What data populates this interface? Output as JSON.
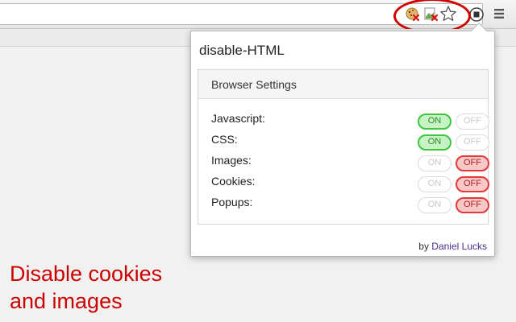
{
  "browser": {
    "extension_icons": [
      "cookie-disabled-icon",
      "image-disabled-icon"
    ],
    "bookmark_icon": "star-icon",
    "action_icon": "extension-action-icon",
    "menu_icon": "menu-icon",
    "highlight_color": "#d10000"
  },
  "popup": {
    "title": "disable-HTML",
    "panel_heading": "Browser Settings",
    "on_label": "ON",
    "off_label": "OFF",
    "settings": [
      {
        "label": "Javascript:",
        "state": "on"
      },
      {
        "label": "CSS:",
        "state": "on"
      },
      {
        "label": "Images:",
        "state": "off"
      },
      {
        "label": "Cookies:",
        "state": "off"
      },
      {
        "label": "Popups:",
        "state": "off"
      }
    ],
    "credit_prefix": "by",
    "credit_author": "Daniel Lucks",
    "colors": {
      "on": "#3ec63e",
      "off": "#e03a3a"
    }
  },
  "caption": {
    "line1": "Disable cookies",
    "line2": "and images",
    "color": "#cc0000"
  }
}
